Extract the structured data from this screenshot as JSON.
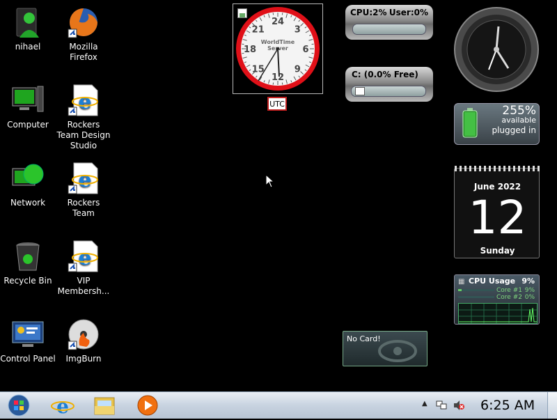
{
  "desktop_icons": [
    {
      "label": "nihael",
      "icon": "user-folder-icon"
    },
    {
      "label": "Mozilla Firefox",
      "icon": "firefox-icon"
    },
    {
      "label": "Computer",
      "icon": "computer-icon"
    },
    {
      "label": "Rockers Team Design Studio",
      "icon": "ie-shortcut-icon"
    },
    {
      "label": "Network",
      "icon": "network-icon"
    },
    {
      "label": "Rockers Team",
      "icon": "ie-shortcut-icon"
    },
    {
      "label": "Recycle Bin",
      "icon": "recycle-bin-icon"
    },
    {
      "label": "VIP Membersh...",
      "icon": "ie-shortcut-icon"
    },
    {
      "label": "Control Panel",
      "icon": "control-panel-icon"
    },
    {
      "label": "ImgBurn",
      "icon": "imgburn-icon"
    }
  ],
  "world_clock": {
    "brand_line1": "WorldTime",
    "brand_line2": "Server",
    "numbers": [
      "24",
      "3",
      "6",
      "9",
      "12",
      "15",
      "18",
      "21"
    ],
    "timezone": "UTC"
  },
  "cpu_meter": {
    "cpu_label": "CPU:2%",
    "user_label": "User:0%",
    "cpu_percent": 2
  },
  "disk_meter": {
    "label": "C: (0.0% Free)",
    "free_percent": 0.0
  },
  "battery": {
    "percent": "255%",
    "status1": "available",
    "status2": "plugged in"
  },
  "calendar": {
    "month_year": "June 2022",
    "day": "12",
    "weekday": "Sunday"
  },
  "cpu_usage": {
    "title": "CPU Usage",
    "total": "9%",
    "cores": [
      {
        "label": "Core #1",
        "value": "9%"
      },
      {
        "label": "Core #2",
        "value": "0%"
      }
    ]
  },
  "gpu_gadget": {
    "label": "No Card!"
  },
  "taskbar": {
    "items": [
      "start-orb",
      "internet-explorer",
      "windows-explorer",
      "media-player"
    ],
    "time": "6:25 AM"
  },
  "colors": {
    "clock_red": "#e01018",
    "taskbar_top": "#e9eef5",
    "calendar_bg": "#111"
  }
}
